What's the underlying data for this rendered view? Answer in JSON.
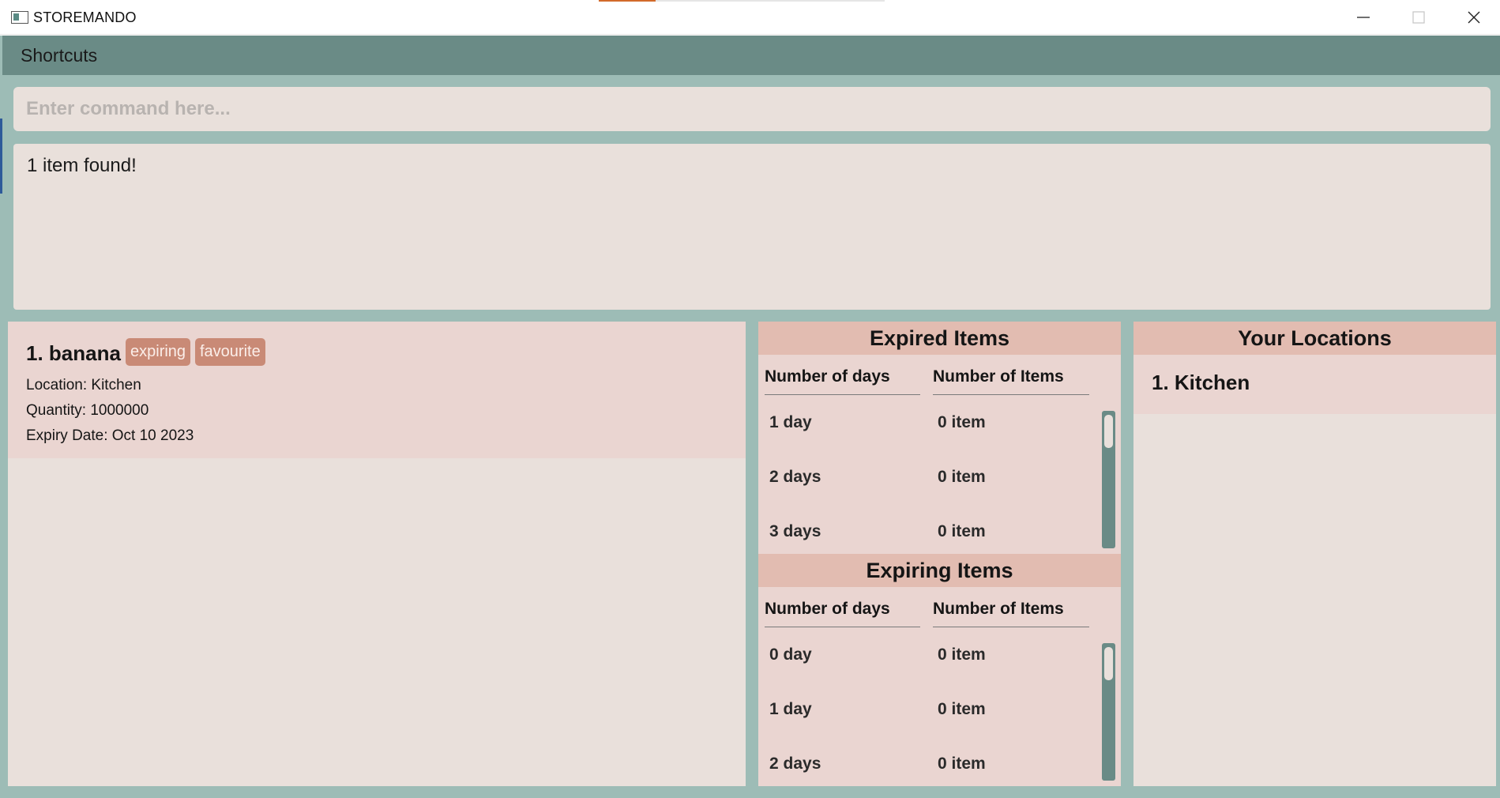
{
  "window": {
    "title": "STOREMANDO"
  },
  "menu": {
    "shortcuts_label": "Shortcuts"
  },
  "command": {
    "placeholder": "Enter command here..."
  },
  "result": {
    "message": "1 item found!"
  },
  "items": [
    {
      "index_name": "1. banana",
      "tags": [
        "expiring",
        "favourite"
      ],
      "location": "Location: Kitchen",
      "quantity": "Quantity: 1000000",
      "expiry": "Expiry Date: Oct 10 2023"
    }
  ],
  "expired": {
    "title": "Expired Items",
    "col_days": "Number of days",
    "col_items": "Number of Items",
    "rows": [
      {
        "days": "1 day",
        "count": "0 item"
      },
      {
        "days": "2 days",
        "count": "0 item"
      },
      {
        "days": "3 days",
        "count": "0 item"
      }
    ]
  },
  "expiring": {
    "title": "Expiring Items",
    "col_days": "Number of days",
    "col_items": "Number of Items",
    "rows": [
      {
        "days": "0 day",
        "count": "0 item"
      },
      {
        "days": "1 day",
        "count": "0 item"
      },
      {
        "days": "2 days",
        "count": "0 item"
      }
    ]
  },
  "locations": {
    "title": "Your Locations",
    "items": [
      "1. Kitchen"
    ]
  },
  "colors": {
    "menubar": "#6a8b86",
    "background": "#9dbcb6",
    "panel": "#e9e0db",
    "card": "#ead5d1",
    "header": "#e2bcb1",
    "tag": "#c98a76"
  }
}
